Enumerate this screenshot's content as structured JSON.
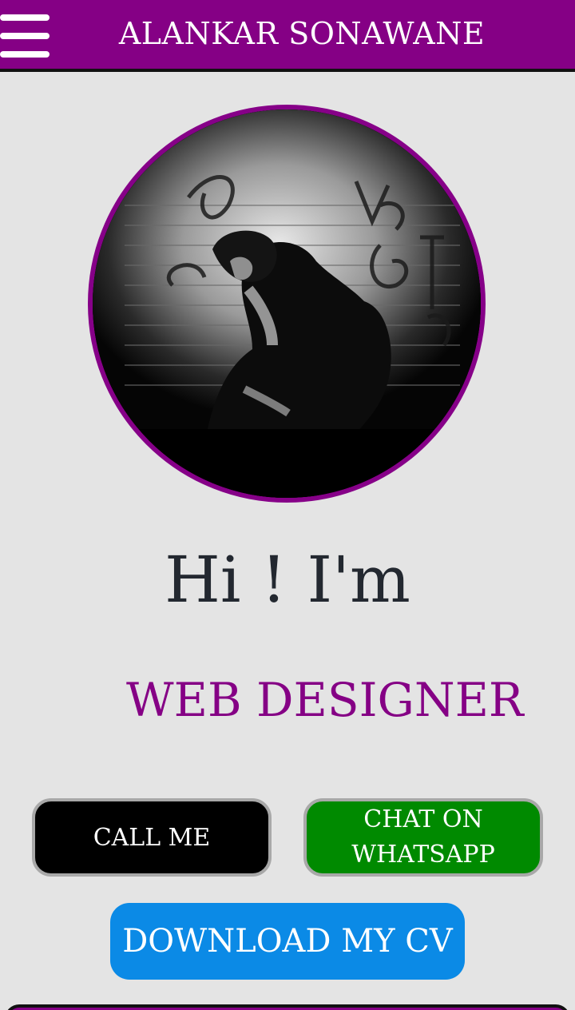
{
  "header": {
    "title": "ALANKAR SONAWANE",
    "menu_icon": "hamburger-menu-icon"
  },
  "hero": {
    "avatar_alt": "profile photo",
    "greeting": "Hi ! I'm",
    "role": "WEB DESIGNER"
  },
  "actions": {
    "call_label": "CALL ME",
    "whatsapp_label_line1": "CHAT ON",
    "whatsapp_label_line2": "WHATSAPP",
    "cv_label": "DOWNLOAD MY CV"
  },
  "colors": {
    "brand_purple": "#850085",
    "background": "#e4e4e4",
    "call_button": "#000000",
    "whatsapp_button": "#008a00",
    "cv_button": "#0b8ae6"
  }
}
